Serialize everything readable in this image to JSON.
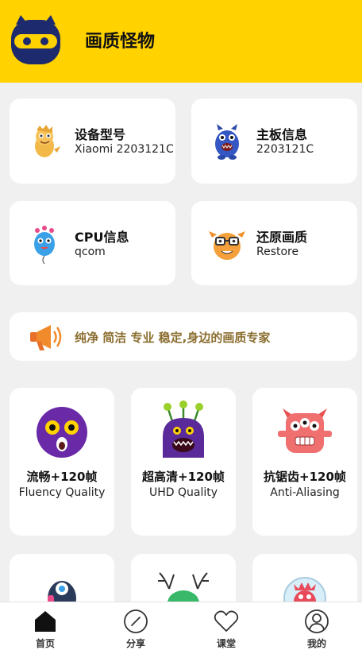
{
  "header": {
    "app_title": "画质怪物",
    "logo_icon": "ninja-monster-logo",
    "background": "#ffd200"
  },
  "info_cards": [
    {
      "title": "设备型号",
      "value": "Xiaomi 2203121C",
      "icon": "yellow-dragon-monster"
    },
    {
      "title": "主板信息",
      "value": "2203121C",
      "icon": "blue-monster"
    },
    {
      "title": "CPU信息",
      "value": "qcom",
      "icon": "balloon-monster"
    },
    {
      "title": "还原画质",
      "value": "Restore",
      "icon": "orange-glasses-monster"
    }
  ],
  "banner": {
    "slogan": "纯净 简洁 专业 稳定,身边的画质专家",
    "icon": "megaphone-icon",
    "text_color": "#8a6d2e"
  },
  "modes": [
    {
      "title": "流畅+120帧",
      "subtitle": "Fluency Quality",
      "icon": "purple-round-monster"
    },
    {
      "title": "超高清+120帧",
      "subtitle": "UHD Quality",
      "icon": "purple-antenna-monster"
    },
    {
      "title": "抗锯齿+120帧",
      "subtitle": "Anti-Aliasing",
      "icon": "red-three-eye-monster"
    }
  ],
  "bottom_nav": [
    {
      "label": "首页",
      "icon": "home-icon",
      "active": true
    },
    {
      "label": "分享",
      "icon": "compass-icon",
      "active": false
    },
    {
      "label": "课堂",
      "icon": "heart-icon",
      "active": false
    },
    {
      "label": "我的",
      "icon": "user-icon",
      "active": false
    }
  ]
}
